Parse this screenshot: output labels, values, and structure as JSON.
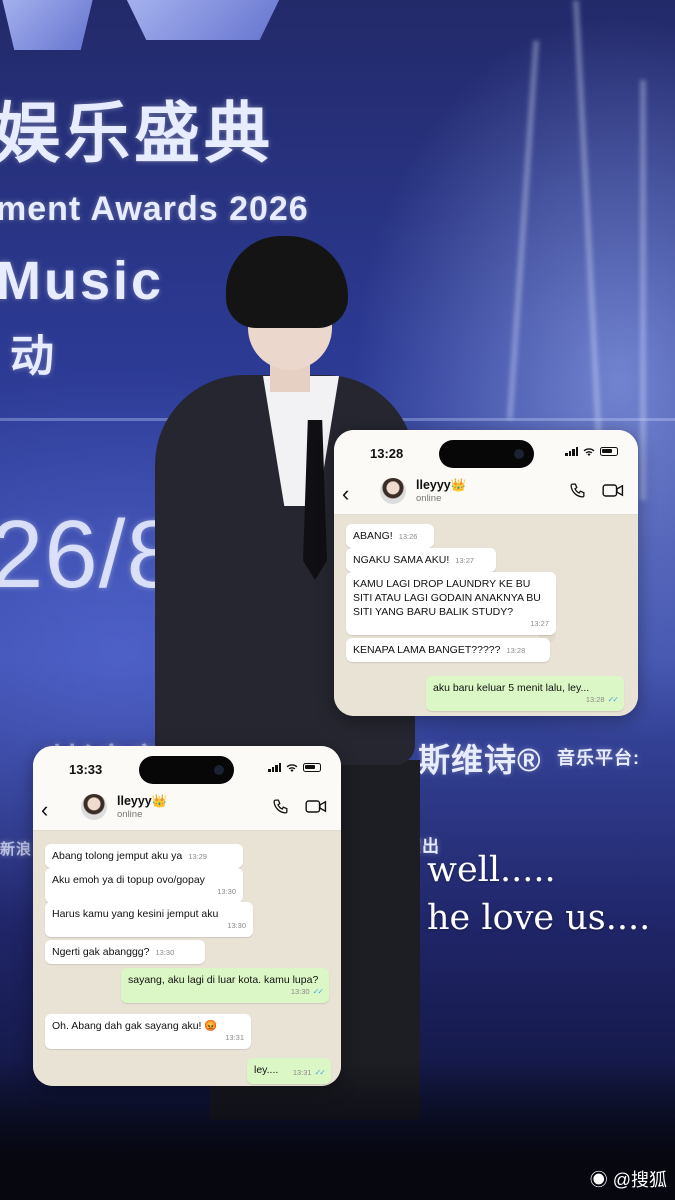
{
  "background": {
    "event_title_cn": "娱乐盛典",
    "event_title_en": "ment Awards 2026",
    "event_sub_en": "Music",
    "event_sub_cn": "动",
    "date_fragment": "26/8",
    "sponsor_cn": "斯维诗®",
    "sponsor_partial_left": "刂长宝字",
    "platform_label": "音乐平台:",
    "partial_left_bottom": "新浪",
    "partial_mid": "演出"
  },
  "overlay": {
    "line1": "well.....",
    "line2": "he love us...."
  },
  "watermark": "@搜狐",
  "chat_top": {
    "time": "13:28",
    "contact_name": "lleyyy",
    "crown": "👑",
    "status": "online",
    "messages": [
      {
        "dir": "in",
        "text": "ABANG!",
        "time": "13:26"
      },
      {
        "dir": "in",
        "text": "NGAKU SAMA AKU!",
        "time": "13:27"
      },
      {
        "dir": "in",
        "text": "KAMU LAGI DROP LAUNDRY KE BU SITI ATAU LAGI GODAIN ANAKNYA BU SITI YANG BARU BALIK STUDY?",
        "time": "13:27"
      },
      {
        "dir": "in",
        "text": "KENAPA LAMA BANGET?????",
        "time": "13:28"
      },
      {
        "dir": "out",
        "text": "aku baru keluar 5 menit lalu, ley...",
        "time": "13:28",
        "ticks": "✓✓"
      }
    ]
  },
  "chat_bottom": {
    "time": "13:33",
    "contact_name": "lleyyy",
    "crown": "👑",
    "status": "online",
    "messages": [
      {
        "dir": "in",
        "text": "Abang tolong jemput aku ya",
        "time": "13:29"
      },
      {
        "dir": "in",
        "text": "Aku emoh ya di topup ovo/gopay",
        "time": "13:30"
      },
      {
        "dir": "in",
        "text": "Harus kamu yang kesini jemput aku",
        "time": "13:30"
      },
      {
        "dir": "in",
        "text": "Ngerti gak abanggg?",
        "time": "13:30"
      },
      {
        "dir": "out",
        "text": "sayang, aku lagi di luar kota. kamu lupa?",
        "time": "13:30",
        "ticks": "✓✓"
      },
      {
        "dir": "in",
        "text": "Oh. Abang dah gak sayang aku! 😡",
        "time": "13:31"
      },
      {
        "dir": "out",
        "text": "ley....",
        "time": "13:31",
        "ticks": "✓✓"
      }
    ]
  },
  "icons": {
    "back": "chevron-left-icon",
    "call": "phone-icon",
    "video": "video-camera-icon",
    "signal": "cellular-signal-icon",
    "wifi": "wifi-icon",
    "battery": "battery-icon"
  }
}
